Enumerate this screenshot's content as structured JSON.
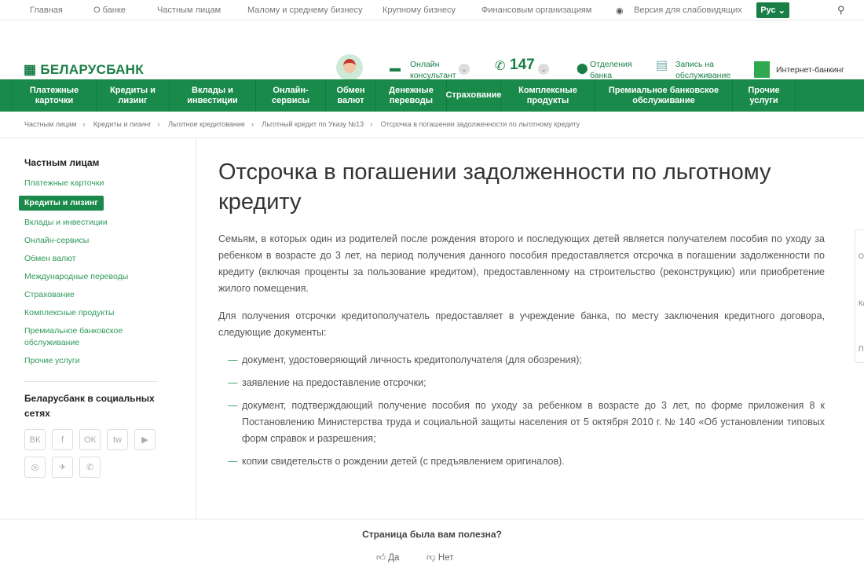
{
  "topbar": {
    "links": [
      "Главная",
      "О банке",
      "Частным лицам",
      "Малому и среднему бизнесу",
      "Крупному бизнесу",
      "Финансовым организациям"
    ],
    "accessibility": "Версия для слабовидящих",
    "lang": "Рус"
  },
  "header": {
    "logo": "БЕЛАРУСБАНК",
    "consultant": "Онлайн консультант",
    "phone": "147",
    "branches": "Отделения банка",
    "appointment": "Запись на обслуживание",
    "ibank": "Интернет-банкинг"
  },
  "nav": [
    "Платежные карточки",
    "Кредиты и лизинг",
    "Вклады и инвестиции",
    "Онлайн-сервисы",
    "Обмен валют",
    "Денежные переводы",
    "Страхование",
    "Комплексные продукты",
    "Премиальное банковское обслуживание",
    "Прочие услуги"
  ],
  "breadcrumb": [
    "Частным лицам",
    "Кредиты и лизинг",
    "Льготное кредитование",
    "Льготный кредит по Указу №13",
    "Отсрочка в погашении задолженности по льготному кредиту"
  ],
  "sidebar": {
    "title": "Частным лицам",
    "items": [
      "Платежные карточки",
      "Кредиты и лизинг",
      "Вклады и инвестиции",
      "Онлайн-сервисы",
      "Обмен валют",
      "Международные переводы",
      "Страхование",
      "Комплексные продукты",
      "Премиальное банковское обслуживание",
      "Прочие услуги"
    ],
    "social_title": "Беларусбанк в социальных сетях",
    "social": [
      "ВК",
      "f",
      "ОК",
      "tw",
      "▶",
      "◎",
      "✈",
      "✆"
    ]
  },
  "main": {
    "title": "Отсрочка в погашении задолженности по льготному кредиту",
    "p1": "Семьям, в которых один из родителей после рождения второго и последующих детей является получателем пособия по уходу за ребенком в возрасте до 3 лет, на период получения данного пособия предоставляется отсрочка в погашении задолженности по кредиту (включая проценты за пользование кредитом), предоставленному на строительство (реконструкцию) или приобретение жилого помещения.",
    "p2": "Для получения отсрочки кредитополучатель предоставляет в учреждение банка, по месту заключения кредитного договора, следующие документы:",
    "list": [
      "документ, удостоверяющий личность кредитополучателя (для обозрения);",
      "заявление на предоставление отсрочки;",
      "документ, подтверждающий получение пособия по уходу за ребенком в возрасте до 3 лет, по форме приложения 8 к Постановлению Министерства труда и социальной защиты населения от 5 октября 2010 г. № 140 «Об установлении типовых форм справок и разрешения;",
      "копии свидетельств о рождении детей (с предъявлением оригиналов)."
    ]
  },
  "feedback": {
    "question": "Страница была вам полезна?",
    "yes": "Да",
    "no": "Нет"
  },
  "widget": [
    "О",
    "Ка",
    "Пр"
  ]
}
